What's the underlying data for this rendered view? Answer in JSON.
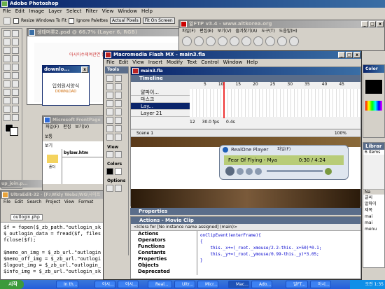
{
  "photoshop": {
    "title": "Adobe Photoshop",
    "menu": [
      "File",
      "Edit",
      "Image",
      "Layer",
      "Select",
      "Filter",
      "View",
      "Window",
      "Help"
    ],
    "options": [
      "Resize Windows To Fit",
      "Ignore Palettes",
      "Actual Pixels",
      "Fit On Screen"
    ],
    "doc_title": "생태며롯2.psd @ 66.7% (Layer 6, RGB)",
    "doc_banner": "아시아수제여관연 한국문화회",
    "popup_title": "downlo...",
    "popup_text": "입회원서양식",
    "popup_sub": "DOWNLOAD",
    "up_title": "up_join.p...",
    "color_title": "Color",
    "libraries_title": "Librar",
    "libraries_count": "6 items",
    "library_header": "Na",
    "library_items": [
      "글씨",
      "알파이",
      "제목",
      "mai",
      "mai",
      "menu"
    ]
  },
  "ftp": {
    "title": "알FTP v3.4 - www.altkorea.org",
    "menu": [
      "파일(F)",
      "편집(E)",
      "보기(V)",
      "즐겨찾기(A)",
      "도구(T)",
      "도움말(H)"
    ]
  },
  "frontpage": {
    "title": "Microsoft FrontPage",
    "menu": [
      "파일(F)",
      "편집",
      "보기(V)"
    ],
    "label1": "보통",
    "label2": "보기",
    "url": "bylaw.htm",
    "folder": "폴더",
    "nav": "보기"
  },
  "ultraedit": {
    "title": "UltraEdit-32 - [F:\\Wkly Webs\\WG\\사이트",
    "menu": [
      "File",
      "Edit",
      "Search",
      "Project",
      "View",
      "Format"
    ],
    "tab": "outlogin.php",
    "code": [
      "$f = fopen($_zb_path.\"outlogin_sk",
      "$_outlogin_data = fread($f, files",
      "fclose($f);",
      "",
      "$memo_on_img = $_zb_url.\"outlogin",
      "$memo_off_img = $_zb_url.\"outlogi",
      "$logout_img = $_zb_url.\"outlogin_",
      "$info_img = $_zb_url.\"outlogin_sk"
    ]
  },
  "flash": {
    "title": "Macromedia Flash MX - main3.fla",
    "menu": [
      "File",
      "Edit",
      "View",
      "Insert",
      "Modify",
      "Text",
      "Control",
      "Window",
      "Help"
    ],
    "doc_title": "main3.fla",
    "timeline_label": "Timeline",
    "frame_numbers": [
      "5",
      "10",
      "15",
      "20",
      "25",
      "30",
      "35",
      "40",
      "45"
    ],
    "layers": [
      "알파이...",
      "마스크",
      "Lay...",
      "Layer 21"
    ],
    "selected_layer": 2,
    "frame": "12",
    "fps": "30.0 fps",
    "time": "0.4s",
    "scene": "Scene 1",
    "zoom": "100%",
    "tools_label": "Tools",
    "view_label": "View",
    "colors_label": "Colors",
    "options_label": "Options",
    "properties": "Properties",
    "actions_title": "Actions - Movie Clip",
    "actions_target": "<Iclera for [No instance name assigned] (main)>",
    "action_categories": [
      "Actions",
      "Operators",
      "Functions",
      "Constants",
      "Properties",
      "Objects",
      "Deprecated"
    ],
    "code": [
      "onClipEvent(enterFrame){",
      "{",
      "    this._x+=(_root._xmouse/2.2-this._x+50)*0.1;",
      "    this._y+=(_root._ymouse/0.99-this._y)*3.05;",
      "}"
    ]
  },
  "realone": {
    "title": "RealOne Player",
    "menu": "파일(F)",
    "track": "Fear Of Flying - Mya",
    "time": "0:30 / 4:24"
  },
  "taskbar": {
    "start": "시작",
    "buttons": [
      "In th...",
      "아시...",
      "아시...",
      "Real...",
      "Ultr...",
      "Micr...",
      "Mac...",
      "Ado...",
      "알FT...",
      "아시..."
    ],
    "clock": "오전 1:35"
  }
}
